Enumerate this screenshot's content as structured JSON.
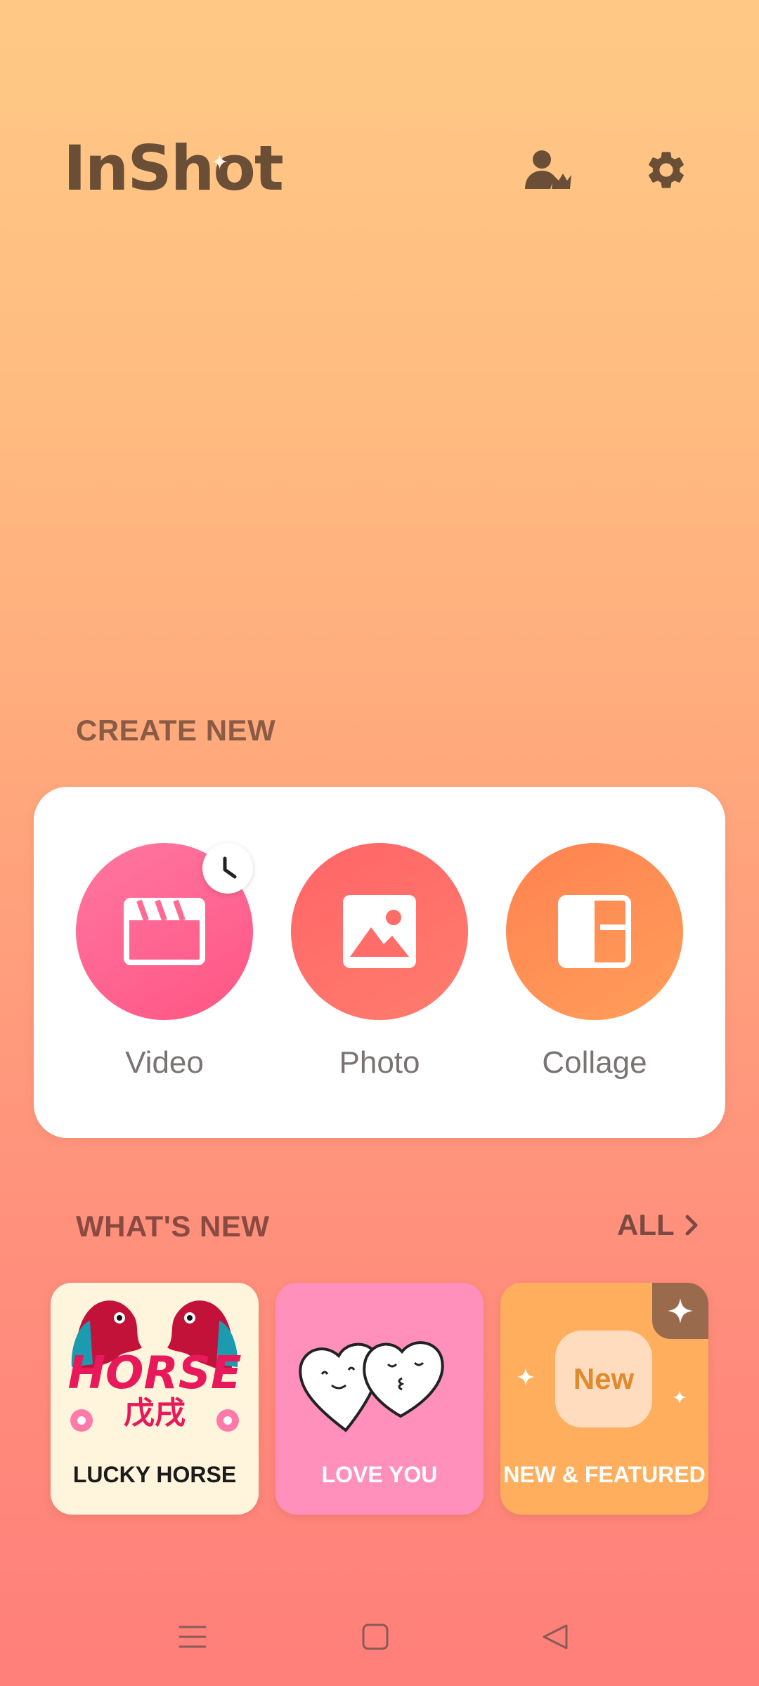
{
  "app": {
    "logo_text": "InShot"
  },
  "header": {
    "vip_icon": "user-crown-icon",
    "settings_icon": "gear-icon"
  },
  "create_new": {
    "title": "CREATE NEW",
    "tools": [
      {
        "label": "Video",
        "icon": "clapperboard-icon",
        "badge_icon": "clock-icon"
      },
      {
        "label": "Photo",
        "icon": "image-icon"
      },
      {
        "label": "Collage",
        "icon": "collage-layout-icon"
      }
    ]
  },
  "whats_new": {
    "title": "WHAT'S NEW",
    "all_label": "ALL",
    "items": [
      {
        "label": "LUCKY HORSE",
        "art_text": "HORSE",
        "art_subtext": "戊戌"
      },
      {
        "label": "LOVE YOU"
      },
      {
        "label": "NEW & FEATURED",
        "pill_text": "New"
      }
    ]
  },
  "colors": {
    "background_top": "#ffc985",
    "background_bottom": "#ff7f7a",
    "video": "#ff5f8e",
    "photo": "#ff6d69",
    "collage": "#ff8a55",
    "logo": "#6a4f36"
  },
  "nav": {
    "menu_icon": "menu-icon",
    "home_icon": "square-home-icon",
    "back_icon": "triangle-back-icon"
  }
}
